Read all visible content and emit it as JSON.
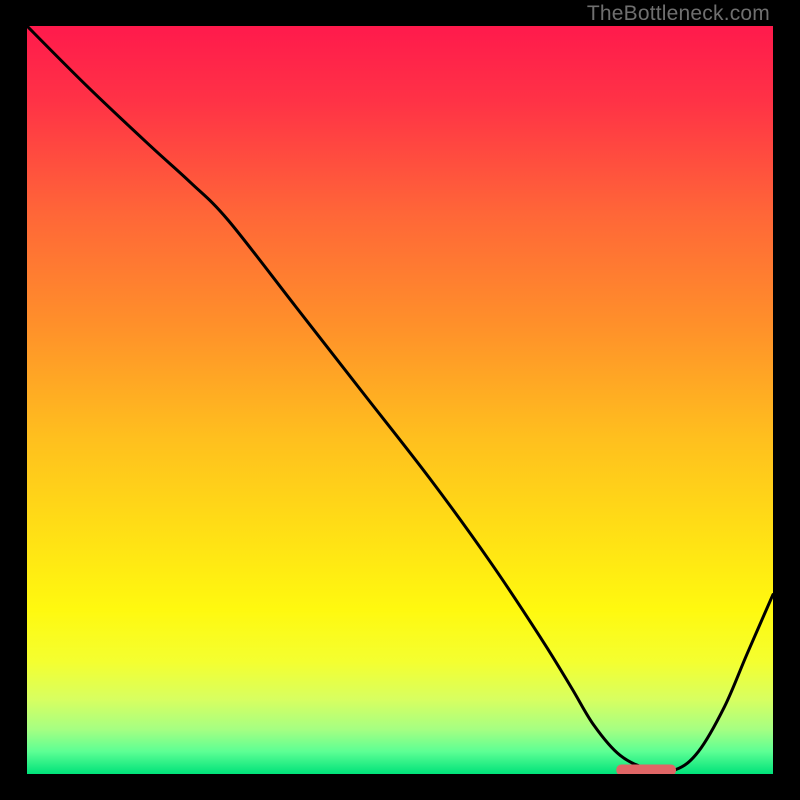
{
  "watermark": "TheBottleneck.com",
  "chart_data": {
    "type": "line",
    "title": "",
    "xlabel": "",
    "ylabel": "",
    "xlim": [
      0,
      100
    ],
    "ylim": [
      0,
      100
    ],
    "background": {
      "type": "vertical-gradient",
      "stops": [
        {
          "pos": 0.0,
          "color": "#ff1a4c"
        },
        {
          "pos": 0.1,
          "color": "#ff3246"
        },
        {
          "pos": 0.25,
          "color": "#ff6638"
        },
        {
          "pos": 0.4,
          "color": "#ff902a"
        },
        {
          "pos": 0.55,
          "color": "#ffbf1e"
        },
        {
          "pos": 0.68,
          "color": "#ffe015"
        },
        {
          "pos": 0.78,
          "color": "#fff90f"
        },
        {
          "pos": 0.85,
          "color": "#f4ff30"
        },
        {
          "pos": 0.9,
          "color": "#d8ff60"
        },
        {
          "pos": 0.94,
          "color": "#a6ff82"
        },
        {
          "pos": 0.97,
          "color": "#5dff94"
        },
        {
          "pos": 1.0,
          "color": "#00e27a"
        }
      ]
    },
    "curve": {
      "x": [
        0.0,
        8.0,
        16.5,
        22.0,
        27.0,
        36.0,
        45.0,
        54.0,
        62.0,
        69.0,
        73.0,
        76.0,
        79.5,
        83.5,
        87.0,
        90.0,
        93.5,
        96.5,
        100.0
      ],
      "y": [
        100.0,
        92.0,
        84.0,
        79.0,
        74.0,
        62.5,
        51.0,
        39.5,
        28.5,
        18.0,
        11.5,
        6.5,
        2.5,
        0.6,
        0.6,
        3.0,
        9.0,
        16.0,
        24.0
      ]
    },
    "marker": {
      "x_start": 79.0,
      "x_end": 87.0,
      "y": 0.6,
      "color": "#e06666"
    }
  }
}
